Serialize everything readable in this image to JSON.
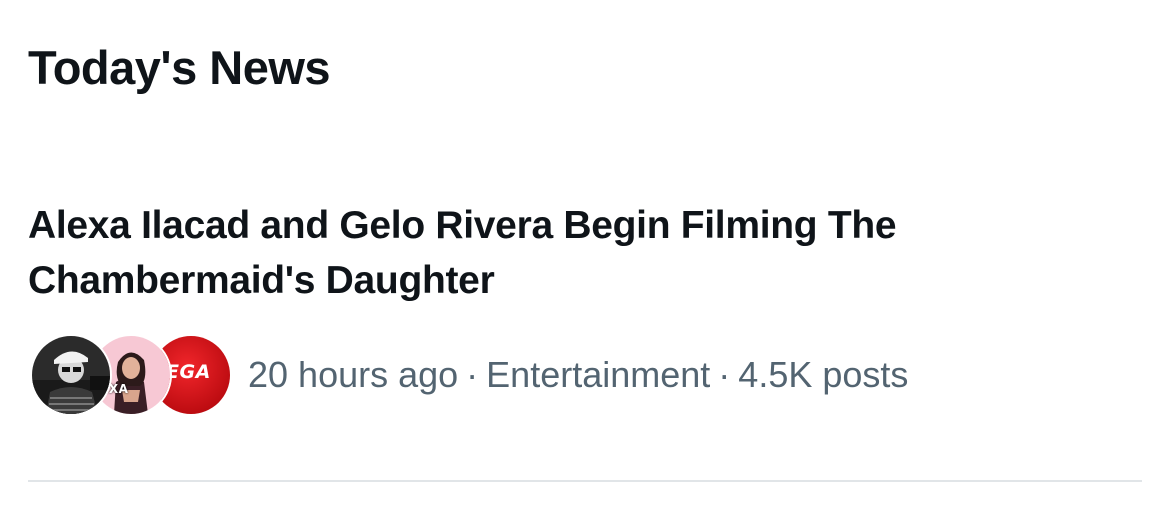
{
  "section": {
    "title": "Today's News"
  },
  "news_item": {
    "headline": "Alexa Ilacad and Gelo Rivera Begin Filming The Chambermaid's Daughter",
    "time_ago": "20 hours ago",
    "separator": "·",
    "category": "Entertainment",
    "post_count": "4.5K posts",
    "avatars": [
      {
        "icon": "person-photo-avatar",
        "label": ""
      },
      {
        "icon": "person-photo-avatar",
        "label": "LEXA"
      },
      {
        "icon": "logo-avatar",
        "label": "EGA"
      }
    ]
  },
  "colors": {
    "text_primary": "#0f1419",
    "text_secondary": "#536471",
    "divider": "#e1e5e8",
    "logo_red": "#d91a1f",
    "pink": "#f4b6c8"
  }
}
